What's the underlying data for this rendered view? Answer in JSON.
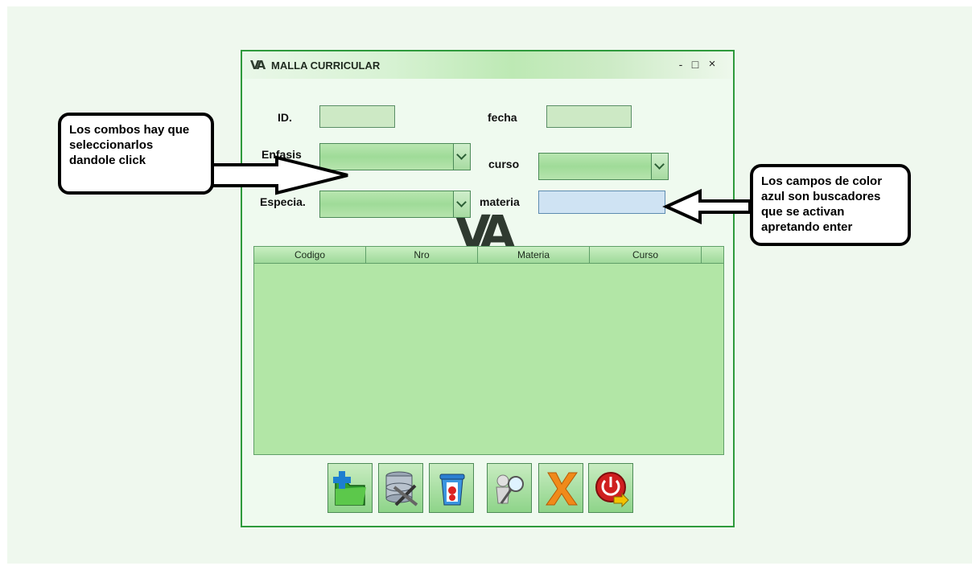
{
  "window": {
    "title": "MALLA CURRICULAR",
    "logo_text": "VA",
    "controls": {
      "minimize": "-",
      "maximize": "□",
      "close": "×"
    }
  },
  "form": {
    "id_label": "ID.",
    "fecha_label": "fecha",
    "enfasis_label": "Enfasis",
    "curso_label": "curso",
    "especia_label": "Especia.",
    "materia_label": "materia",
    "id_value": "",
    "fecha_value": "",
    "materia_value": "",
    "enfasis_value": "",
    "curso_value": "",
    "especia_value": ""
  },
  "watermark": "VA",
  "table": {
    "columns": [
      "Codigo",
      "Nro",
      "Materia",
      "Curso"
    ],
    "rows": []
  },
  "toolbar": {
    "buttons": [
      "new-folder-icon",
      "database-settings-icon",
      "delete-bin-icon",
      "search-user-icon",
      "cancel-x-icon",
      "power-exit-icon"
    ]
  },
  "annotations": {
    "left": [
      "Los combos hay que",
      "seleccionarlos",
      "dandole click"
    ],
    "right": [
      "Los campos de color",
      "azul son buscadores",
      "que se activan",
      "apretando enter"
    ]
  },
  "colors": {
    "window_border": "#2e9a3c",
    "field_green": "#cde9c5",
    "field_blue": "#cfe3f3",
    "grid_bg": "#b2e6a6"
  }
}
